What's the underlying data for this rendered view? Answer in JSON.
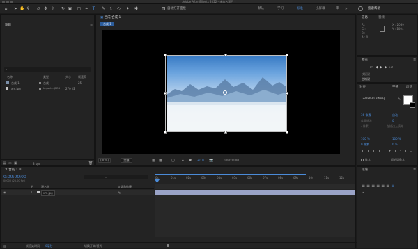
{
  "window_title": "Adobe After Effects 2022 - 未命名项目 *",
  "toolbar": {
    "auto_open_label": "自动打开面板",
    "workspaces": [
      "默认",
      "学习",
      "标准",
      "小屏幕",
      "库"
    ],
    "tools": [
      "home-icon",
      "select-icon",
      "hand-icon",
      "zoom-icon",
      "orbit-icon",
      "pan-icon",
      "dolly-icon",
      "rotate-icon",
      "rect-icon",
      "pen-icon",
      "type-icon",
      "brush-icon",
      "clone-icon",
      "eraser-icon",
      "roto-icon",
      "puppet-icon"
    ]
  },
  "project": {
    "title": "项目",
    "search_placeholder": "⌕",
    "columns": [
      "名称",
      "类型",
      "大小",
      "帧速率"
    ],
    "items": [
      {
        "name": "合成 1",
        "type": "合成",
        "size": "",
        "fps": "25"
      },
      {
        "name": "xm.jpg",
        "type": "Importe..JPEG",
        "size": "270 KB",
        "fps": ""
      }
    ],
    "bpc": "8 bpc"
  },
  "composition": {
    "panel_title": "合成 合成 1",
    "tab": "合成 1",
    "zoom": "(80%)",
    "resolution": "(完整)",
    "exposure": "+0.0",
    "timecode": "0:00:00:00"
  },
  "info": {
    "tab": "信息",
    "tab2": "音频",
    "r": "R :",
    "g": "G :",
    "b": "B :",
    "a": "A : 0",
    "x": "X : 2089",
    "y": "Y : 1004",
    "search_label": "搜索帮助"
  },
  "preview": {
    "title": "预览",
    "shortcut_label": "快捷键",
    "shortcut_value": "空格键"
  },
  "character": {
    "tabs": [
      "对齐",
      "字符",
      "段落"
    ],
    "font": "GB18030 Bitmap",
    "font_size": "36 像素",
    "leading": "自动",
    "kerning": "度量标准",
    "tracking": "0",
    "stroke": "- 像素",
    "stroke_mode": "在描边上填充",
    "v_scale": "100 %",
    "h_scale": "100 %",
    "baseline": "0 像素",
    "tsume": "0 %",
    "ligature_label": "连字",
    "hindi_label": "印地语数字",
    "style_buttons": [
      "T",
      "T",
      "TT",
      "Tt",
      "T¹",
      "T₁"
    ]
  },
  "timeline": {
    "tab": "合成 1",
    "timecode": "0:00:00:00",
    "fps_info": "00000 (25.00 fps)",
    "columns": [
      "#",
      "源名称",
      "父级和链接"
    ],
    "layer": {
      "index": "1",
      "name": "xm.jpg",
      "parent": "无"
    },
    "ruler": [
      "0s",
      "01s",
      "02s",
      "03s",
      "04s",
      "05s",
      "06s",
      "07s",
      "08s",
      "09s",
      "10s",
      "11s",
      "12s"
    ],
    "footer_left": "帧渲染时间",
    "footer_time": "0毫秒",
    "footer_toggle": "切换开关/模式"
  },
  "paragraph": {
    "title": "段落"
  },
  "colors": {
    "accent": "#4b8bd8",
    "bg": "#1b1b1b",
    "panel": "#232323"
  }
}
